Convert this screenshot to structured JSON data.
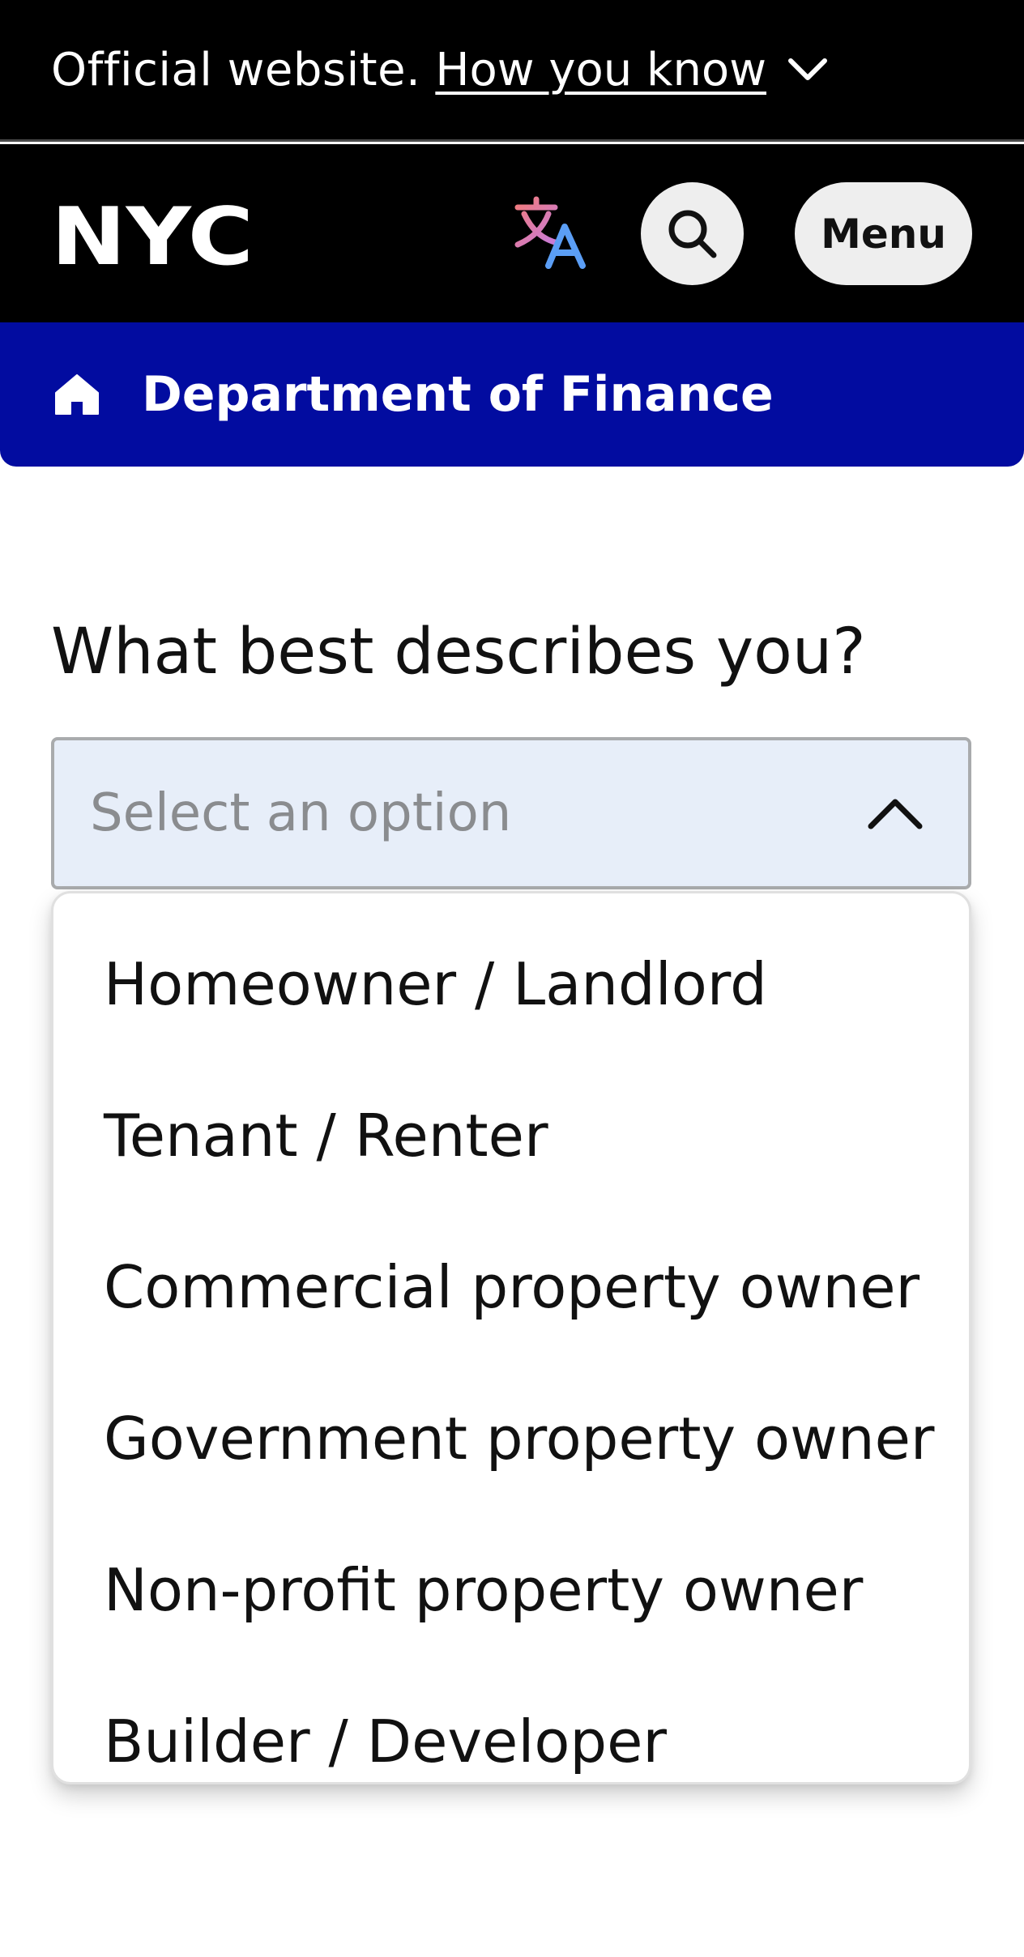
{
  "official_banner": {
    "text": "Official website.",
    "link_label": "How you know"
  },
  "header": {
    "logo_text": "NYC",
    "menu_label": "Menu"
  },
  "department": {
    "name": "Department of Finance"
  },
  "form": {
    "question": "What best describes you?",
    "select": {
      "placeholder": "Select an option",
      "expanded": true
    },
    "options": [
      "Homeowner / Landlord",
      "Tenant / Renter",
      "Commercial property owner",
      "Government property owner",
      "Non-profit property owner",
      "Builder / Developer"
    ]
  },
  "colors": {
    "banner_bg": "#000000",
    "department_bar": "#020ca0",
    "select_bg": "#e7eef9",
    "button_bg": "#eeeeee"
  },
  "icons": {
    "how_you_know": "chevron-down-icon",
    "translate": "translate-icon",
    "search": "search-icon",
    "department": "home-icon",
    "select": "chevron-up-icon"
  }
}
